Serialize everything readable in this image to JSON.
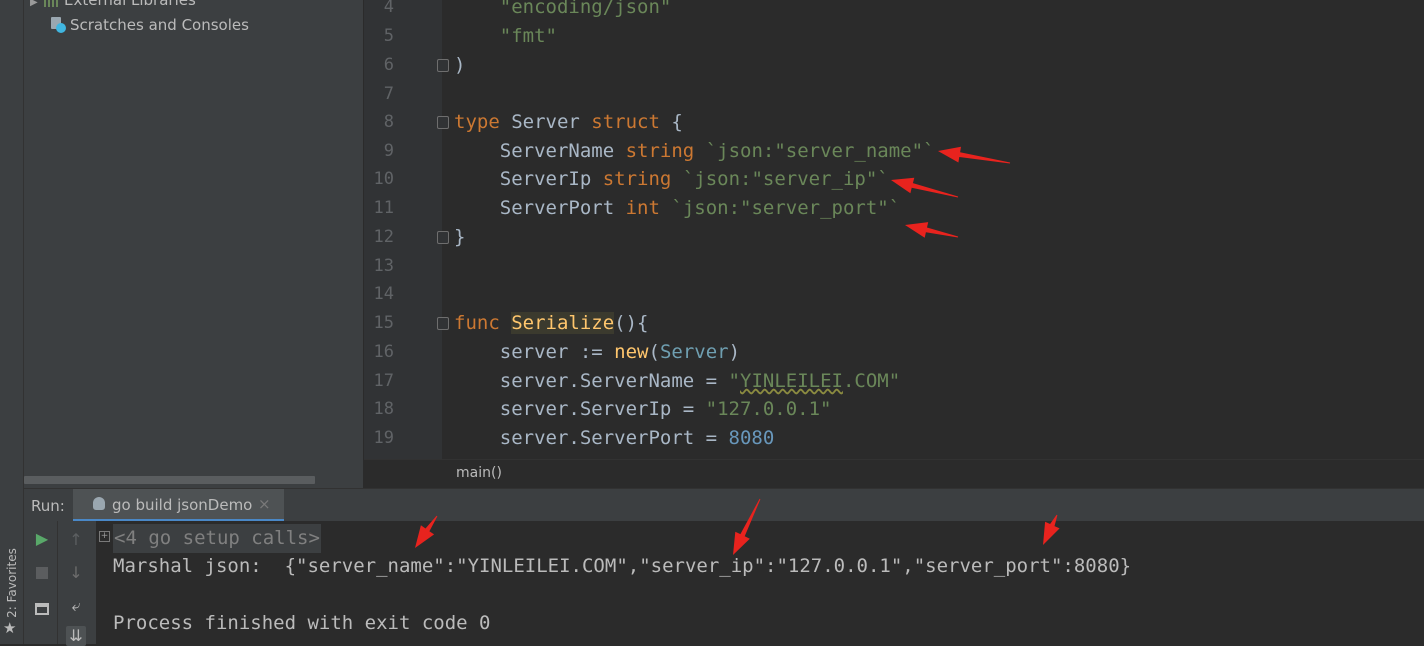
{
  "project_tree": {
    "items": [
      {
        "label": "External Libraries",
        "icon": "library-icon"
      },
      {
        "label": "Scratches and Consoles",
        "icon": "scratches-icon"
      }
    ]
  },
  "editor": {
    "line_numbers": [
      "4",
      "5",
      "6",
      "7",
      "8",
      "9",
      "10",
      "11",
      "12",
      "13",
      "14",
      "15",
      "16",
      "17",
      "18",
      "19"
    ],
    "breadcrumb": "main()"
  },
  "sidebar": {
    "favorites_label": "2: Favorites"
  },
  "run_panel": {
    "label": "Run:",
    "tab_label": "go build jsonDemo",
    "tab_close": "×",
    "console": {
      "collapsed": "<4 go setup calls>",
      "line1": "Marshal json:  {\"server_name\":\"YINLEILEI.COM\",\"server_ip\":\"127.0.0.1\",\"server_port\":8080}",
      "line2": "Process finished with exit code 0"
    }
  },
  "annotation_color": "#e8231e"
}
